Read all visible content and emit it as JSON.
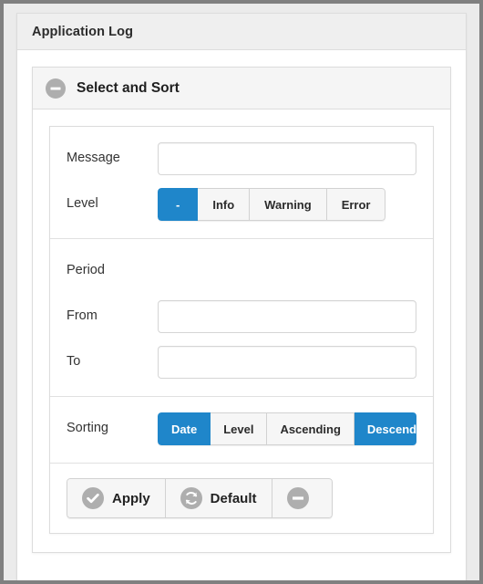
{
  "window": {
    "title": "Application Log"
  },
  "section": {
    "title": "Select and Sort",
    "collapse_icon": "minus-circle-icon"
  },
  "form": {
    "message": {
      "label": "Message",
      "value": "",
      "placeholder": ""
    },
    "level": {
      "label": "Level",
      "options": [
        {
          "label": "-",
          "active": true
        },
        {
          "label": "Info",
          "active": false
        },
        {
          "label": "Warning",
          "active": false
        },
        {
          "label": "Error",
          "active": false
        }
      ]
    },
    "period": {
      "label": "Period",
      "from": {
        "label": "From",
        "value": "",
        "placeholder": ""
      },
      "to": {
        "label": "To",
        "value": "",
        "placeholder": ""
      }
    },
    "sorting": {
      "label": "Sorting",
      "options": [
        {
          "label": "Date",
          "active": true
        },
        {
          "label": "Level",
          "active": false
        },
        {
          "label": "Ascending",
          "active": false
        },
        {
          "label": "Descending",
          "active": true
        }
      ]
    }
  },
  "actions": {
    "apply": {
      "label": "Apply",
      "icon": "check-circle-icon"
    },
    "default": {
      "label": "Default",
      "icon": "reset-circle-icon"
    },
    "collapse": {
      "label": "",
      "icon": "minus-circle-icon"
    }
  },
  "colors": {
    "accent": "#1f86ca",
    "icon_gray": "#aeaeae",
    "frame": "#808080",
    "header_bg": "#efefef",
    "section_header_bg": "#f5f5f5",
    "border": "#dcdcdc"
  }
}
